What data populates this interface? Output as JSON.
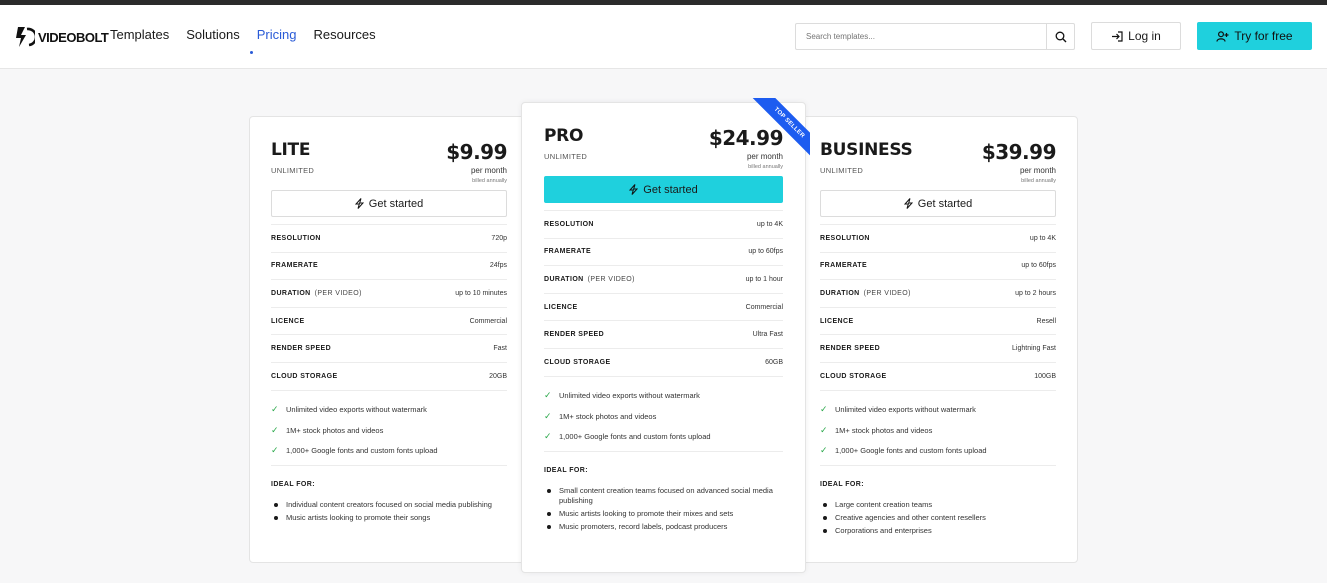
{
  "brand": {
    "name": "VIDEOBOLT"
  },
  "nav": {
    "items": [
      "Templates",
      "Solutions",
      "Pricing",
      "Resources"
    ],
    "active": "Pricing"
  },
  "search": {
    "placeholder": "Search templates..."
  },
  "header": {
    "login_label": "Log in",
    "try_label": "Try for free"
  },
  "colors": {
    "accent": "#1fd0dd",
    "ribbon": "#1d5cf0",
    "active_link": "#2a5bd7",
    "check": "#2aa84a"
  },
  "plans": [
    {
      "name": "LITE",
      "sub": "UNLIMITED",
      "price": "$9.99",
      "per": "per month",
      "billing": "billed annually",
      "cta": "Get started",
      "specs": [
        {
          "key": "RESOLUTION",
          "sub": "",
          "value": "720p"
        },
        {
          "key": "FRAMERATE",
          "sub": "",
          "value": "24fps"
        },
        {
          "key": "DURATION",
          "sub": "(PER VIDEO)",
          "value": "up to 10 minutes"
        },
        {
          "key": "LICENCE",
          "sub": "",
          "value": "Commercial"
        },
        {
          "key": "RENDER SPEED",
          "sub": "",
          "value": "Fast"
        },
        {
          "key": "CLOUD STORAGE",
          "sub": "",
          "value": "20GB"
        }
      ],
      "features": [
        "Unlimited video exports without watermark",
        "1M+ stock photos and videos",
        "1,000+ Google fonts and custom fonts upload"
      ],
      "ideal_heading": "IDEAL FOR:",
      "ideal": [
        "Individual content creators focused on social media publishing",
        "Music artists looking to promote their songs"
      ]
    },
    {
      "name": "PRO",
      "sub": "UNLIMITED",
      "price": "$24.99",
      "per": "per month",
      "billing": "billed annually",
      "cta": "Get started",
      "ribbon": "TOP SELLER",
      "specs": [
        {
          "key": "RESOLUTION",
          "sub": "",
          "value": "up to 4K"
        },
        {
          "key": "FRAMERATE",
          "sub": "",
          "value": "up to 60fps"
        },
        {
          "key": "DURATION",
          "sub": "(PER VIDEO)",
          "value": "up to 1 hour"
        },
        {
          "key": "LICENCE",
          "sub": "",
          "value": "Commercial"
        },
        {
          "key": "RENDER SPEED",
          "sub": "",
          "value": "Ultra Fast"
        },
        {
          "key": "CLOUD STORAGE",
          "sub": "",
          "value": "60GB"
        }
      ],
      "features": [
        "Unlimited video exports without watermark",
        "1M+ stock photos and videos",
        "1,000+ Google fonts and custom fonts upload"
      ],
      "ideal_heading": "IDEAL FOR:",
      "ideal": [
        "Small content creation teams focused on advanced social media publishing",
        "Music artists looking to promote their mixes and sets",
        "Music promoters, record labels, podcast producers"
      ]
    },
    {
      "name": "BUSINESS",
      "sub": "UNLIMITED",
      "price": "$39.99",
      "per": "per month",
      "billing": "billed annually",
      "cta": "Get started",
      "specs": [
        {
          "key": "RESOLUTION",
          "sub": "",
          "value": "up to 4K"
        },
        {
          "key": "FRAMERATE",
          "sub": "",
          "value": "up to 60fps"
        },
        {
          "key": "DURATION",
          "sub": "(PER VIDEO)",
          "value": "up to 2 hours"
        },
        {
          "key": "LICENCE",
          "sub": "",
          "value": "Resell"
        },
        {
          "key": "RENDER SPEED",
          "sub": "",
          "value": "Lightning Fast"
        },
        {
          "key": "CLOUD STORAGE",
          "sub": "",
          "value": "100GB"
        }
      ],
      "features": [
        "Unlimited video exports without watermark",
        "1M+ stock photos and videos",
        "1,000+ Google fonts and custom fonts upload"
      ],
      "ideal_heading": "IDEAL FOR:",
      "ideal": [
        "Large content creation teams",
        "Creative agencies and other content resellers",
        "Corporations and enterprises"
      ]
    }
  ]
}
